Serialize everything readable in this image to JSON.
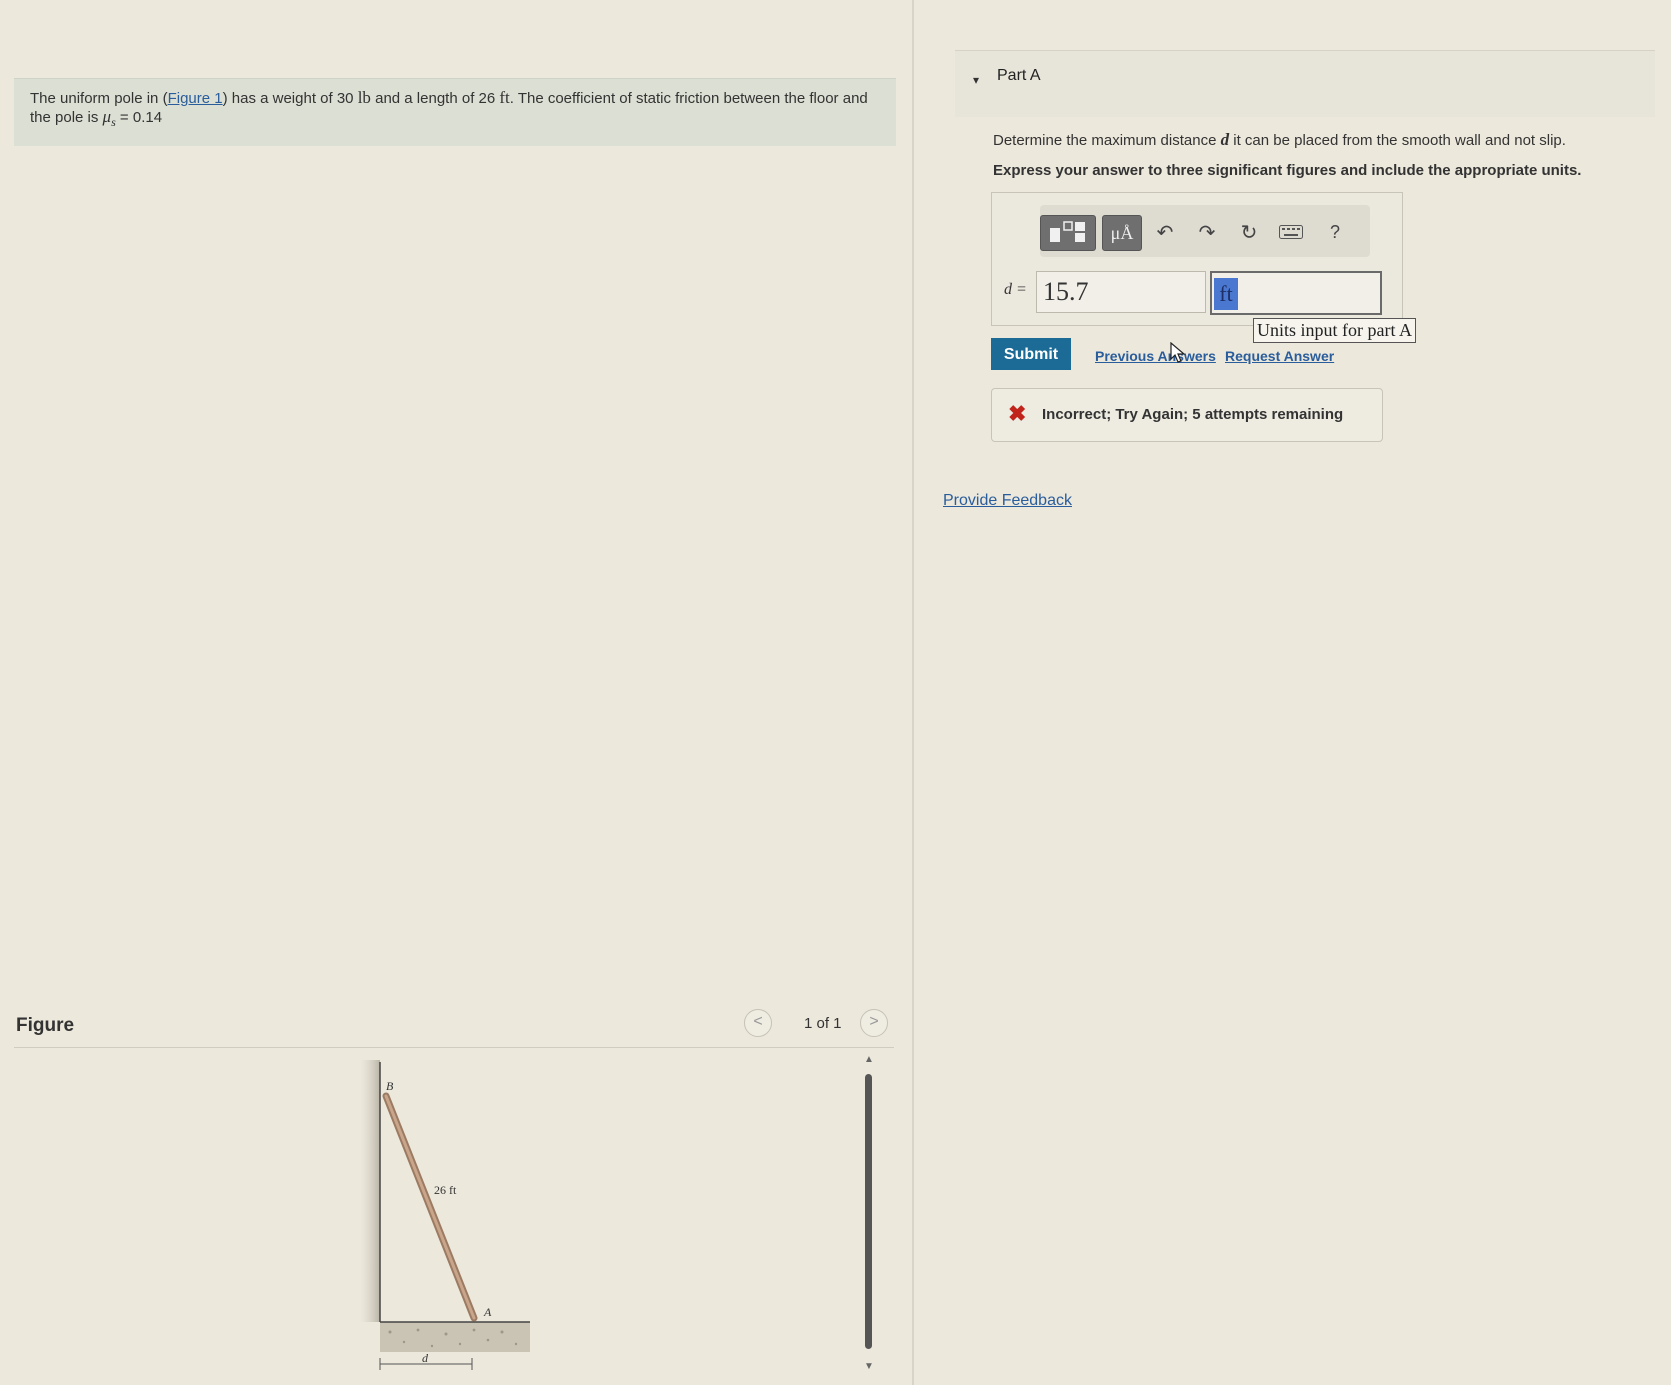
{
  "problem": {
    "prefix": "The uniform pole in (",
    "figure_link": "Figure 1",
    "middle": ") has a weight of 30 ",
    "weight_unit": "lb",
    "mid2": " and a length of 26 ",
    "length_unit": "ft",
    "suffix": ". The coefficient of static friction between the floor and the pole is ",
    "mu_symbol": "μ",
    "mu_sub": "s",
    "mu_value": " = 0.14"
  },
  "figure": {
    "title": "Figure",
    "pager": "1 of 1",
    "prev_icon": "<",
    "next_icon": ">",
    "label_B": "B",
    "label_A": "A",
    "label_length": "26 ft",
    "label_d": "d"
  },
  "part": {
    "title": "Part A",
    "caret_icon": "▾",
    "question_prefix": "Determine the maximum distance ",
    "question_var": "d",
    "question_suffix": " it can be placed from the smooth wall and not slip.",
    "instruction": "Express your answer to three significant figures and include the appropriate units."
  },
  "toolbar": {
    "units_button": "μÅ",
    "help": "?"
  },
  "answer": {
    "label": "d =",
    "value": "15.7",
    "units_value": "ft",
    "units_tooltip": "Units input for part A"
  },
  "actions": {
    "submit": "Submit",
    "previous_answers": "Previous Answers",
    "request_answer": "Request Answer"
  },
  "feedback": {
    "icon": "✖",
    "text": "Incorrect; Try Again; 5 attempts remaining"
  },
  "provide_feedback": "Provide Feedback",
  "colors": {
    "background": "#ece8dc",
    "link": "#2a5d9c",
    "submit": "#1b6b96",
    "error": "#c0241b"
  }
}
